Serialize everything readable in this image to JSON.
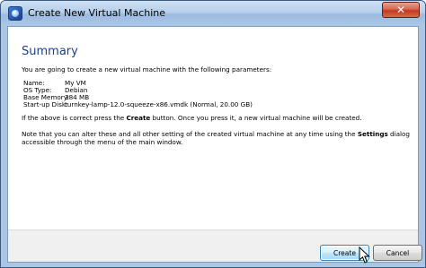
{
  "window": {
    "title": "Create New Virtual Machine",
    "close_symbol": "✕"
  },
  "summary": {
    "title": "Summary",
    "intro": "You are going to create a new virtual machine with the following parameters:",
    "params": [
      {
        "label": "Name:",
        "value": "My VM"
      },
      {
        "label": "OS Type:",
        "value": "Debian"
      },
      {
        "label": "Base Memory:",
        "value": "384 MB"
      },
      {
        "label": "Start-up Disk:",
        "value": "turnkey-lamp-12.0-squeeze-x86.vmdk (Normal, 20.00 GB)"
      }
    ],
    "note1": {
      "pre": "If the above is correct press the ",
      "bold": "Create",
      "post": " button. Once you press it, a new virtual machine will be created."
    },
    "note2": {
      "pre": "Note that you can alter these and all other setting of the created virtual machine at any time using the ",
      "bold": "Settings",
      "post": " dialog accessible through the menu of the main window."
    }
  },
  "buttons": {
    "create": "Create",
    "cancel": "Cancel"
  }
}
